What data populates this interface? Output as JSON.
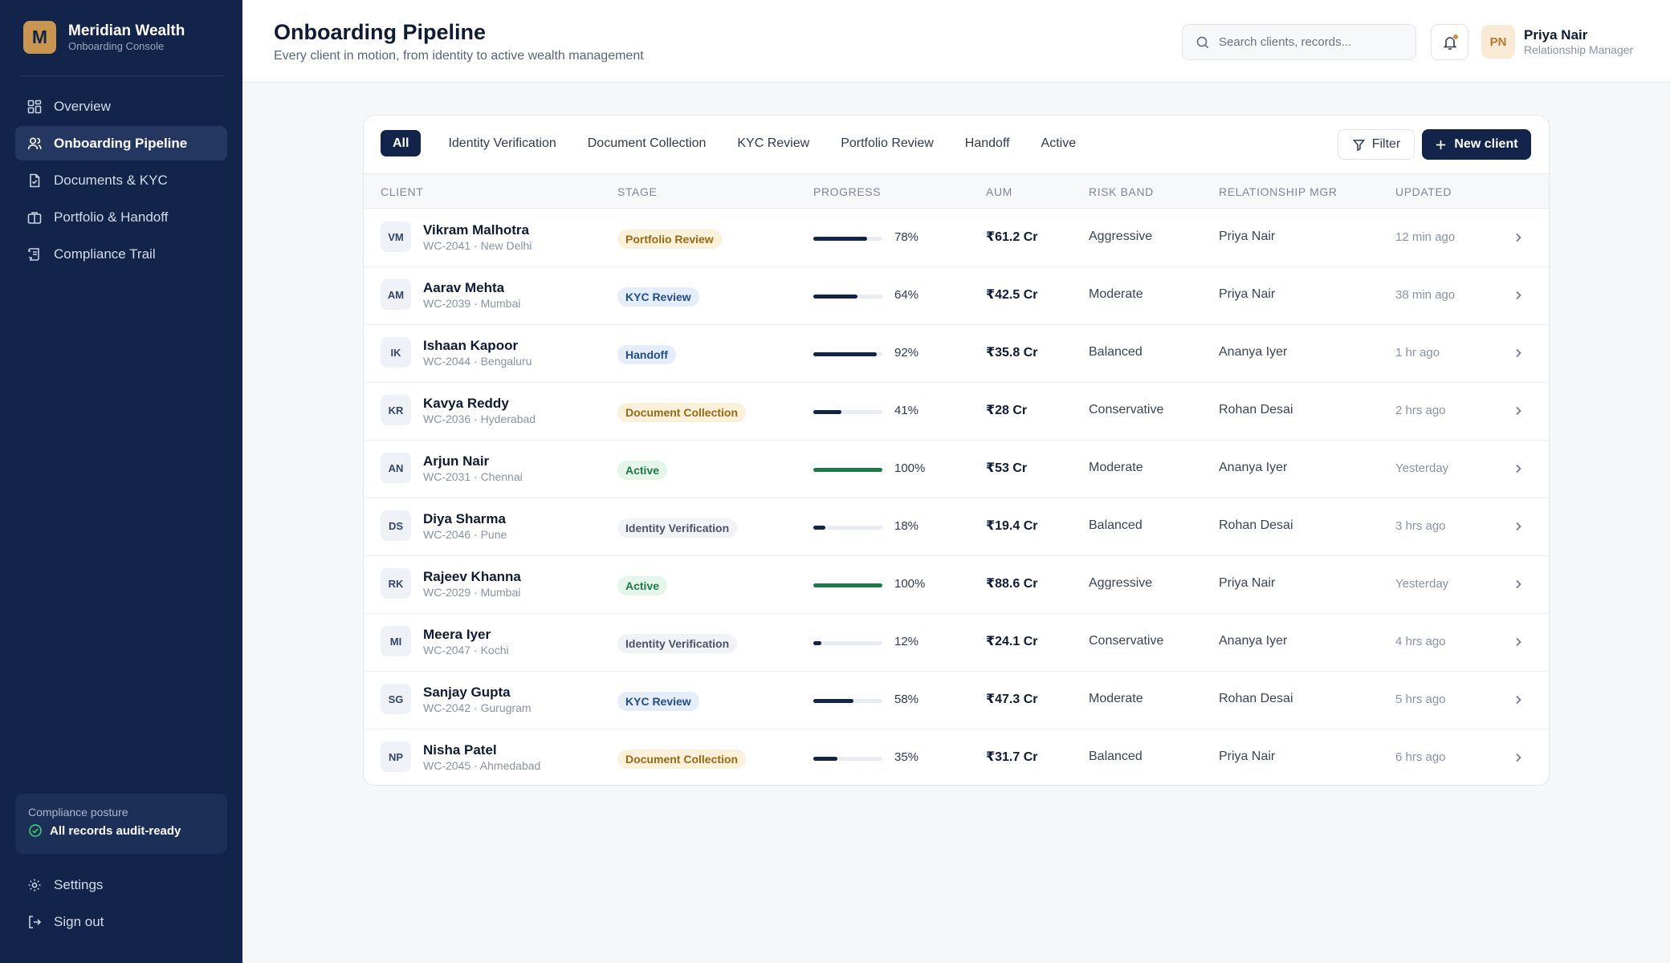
{
  "brand": {
    "initial": "M",
    "name": "Meridian Wealth",
    "subtitle": "Onboarding Console"
  },
  "nav": [
    {
      "label": "Overview",
      "icon": "grid-icon"
    },
    {
      "label": "Onboarding Pipeline",
      "icon": "users-icon",
      "active": true
    },
    {
      "label": "Documents & KYC",
      "icon": "document-check-icon"
    },
    {
      "label": "Portfolio & Handoff",
      "icon": "briefcase-icon"
    },
    {
      "label": "Compliance Trail",
      "icon": "scroll-icon"
    }
  ],
  "compliance": {
    "label": "Compliance posture",
    "status": "All records audit-ready"
  },
  "bottom_nav": {
    "settings": "Settings",
    "signout": "Sign out"
  },
  "header": {
    "title": "Onboarding Pipeline",
    "subtitle": "Every client in motion, from identity to active wealth management",
    "search_placeholder": "Search clients, records...",
    "user_initials": "PN",
    "user_name": "Priya Nair",
    "user_role": "Relationship Manager"
  },
  "tabs": [
    "All",
    "Identity Verification",
    "Document Collection",
    "KYC Review",
    "Portfolio Review",
    "Handoff",
    "Active"
  ],
  "actions": {
    "filter": "Filter",
    "new_client": "New client"
  },
  "columns": {
    "client": "CLIENT",
    "stage": "STAGE",
    "progress": "PROGRESS",
    "aum": "AUM",
    "risk": "RISK BAND",
    "manager": "RELATIONSHIP MGR",
    "updated": "UPDATED"
  },
  "colors": {
    "sidebar": "#13244a",
    "accent": "#c8964e",
    "progress": "#13244a",
    "progress_done": "#1b7a45"
  },
  "clients": [
    {
      "initials": "VM",
      "name": "Vikram Malhotra",
      "meta": "WC-2041 · New Delhi",
      "stage": "Portfolio Review",
      "tone": "amber",
      "progress": 78,
      "pct": "78%",
      "aum": "₹61.2 Cr",
      "risk": "Aggressive",
      "manager": "Priya Nair",
      "updated": "12 min ago"
    },
    {
      "initials": "AM",
      "name": "Aarav Mehta",
      "meta": "WC-2039 · Mumbai",
      "stage": "KYC Review",
      "tone": "blue",
      "progress": 64,
      "pct": "64%",
      "aum": "₹42.5 Cr",
      "risk": "Moderate",
      "manager": "Priya Nair",
      "updated": "38 min ago"
    },
    {
      "initials": "IK",
      "name": "Ishaan Kapoor",
      "meta": "WC-2044 · Bengaluru",
      "stage": "Handoff",
      "tone": "blue",
      "progress": 92,
      "pct": "92%",
      "aum": "₹35.8 Cr",
      "risk": "Balanced",
      "manager": "Ananya Iyer",
      "updated": "1 hr ago"
    },
    {
      "initials": "KR",
      "name": "Kavya Reddy",
      "meta": "WC-2036 · Hyderabad",
      "stage": "Document Collection",
      "tone": "amber",
      "progress": 41,
      "pct": "41%",
      "aum": "₹28 Cr",
      "risk": "Conservative",
      "manager": "Rohan Desai",
      "updated": "2 hrs ago"
    },
    {
      "initials": "AN",
      "name": "Arjun Nair",
      "meta": "WC-2031 · Chennai",
      "stage": "Active",
      "tone": "green",
      "progress": 100,
      "pct": "100%",
      "aum": "₹53 Cr",
      "risk": "Moderate",
      "manager": "Ananya Iyer",
      "updated": "Yesterday"
    },
    {
      "initials": "DS",
      "name": "Diya Sharma",
      "meta": "WC-2046 · Pune",
      "stage": "Identity Verification",
      "tone": "grey",
      "progress": 18,
      "pct": "18%",
      "aum": "₹19.4 Cr",
      "risk": "Balanced",
      "manager": "Rohan Desai",
      "updated": "3 hrs ago"
    },
    {
      "initials": "RK",
      "name": "Rajeev Khanna",
      "meta": "WC-2029 · Mumbai",
      "stage": "Active",
      "tone": "green",
      "progress": 100,
      "pct": "100%",
      "aum": "₹88.6 Cr",
      "risk": "Aggressive",
      "manager": "Priya Nair",
      "updated": "Yesterday"
    },
    {
      "initials": "MI",
      "name": "Meera Iyer",
      "meta": "WC-2047 · Kochi",
      "stage": "Identity Verification",
      "tone": "grey",
      "progress": 12,
      "pct": "12%",
      "aum": "₹24.1 Cr",
      "risk": "Conservative",
      "manager": "Ananya Iyer",
      "updated": "4 hrs ago"
    },
    {
      "initials": "SG",
      "name": "Sanjay Gupta",
      "meta": "WC-2042 · Gurugram",
      "stage": "KYC Review",
      "tone": "blue",
      "progress": 58,
      "pct": "58%",
      "aum": "₹47.3 Cr",
      "risk": "Moderate",
      "manager": "Rohan Desai",
      "updated": "5 hrs ago"
    },
    {
      "initials": "NP",
      "name": "Nisha Patel",
      "meta": "WC-2045 · Ahmedabad",
      "stage": "Document Collection",
      "tone": "amber",
      "progress": 35,
      "pct": "35%",
      "aum": "₹31.7 Cr",
      "risk": "Balanced",
      "manager": "Priya Nair",
      "updated": "6 hrs ago"
    }
  ]
}
